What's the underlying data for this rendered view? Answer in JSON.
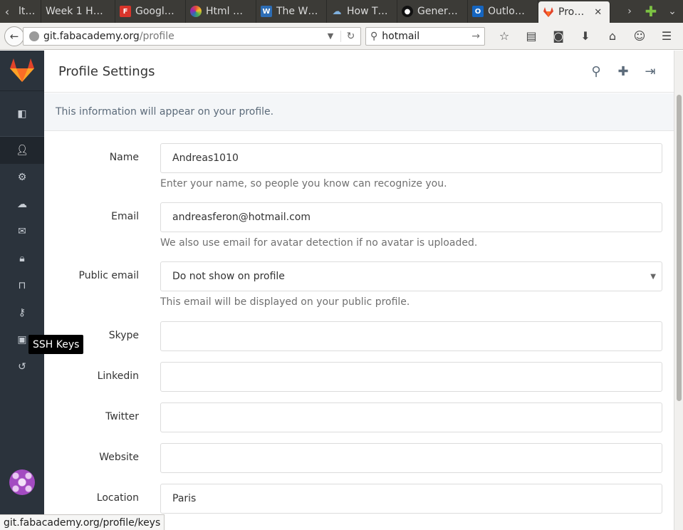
{
  "browser": {
    "tabs": [
      {
        "label": "lt…",
        "icon": "page-icon",
        "color": "#555555"
      },
      {
        "label": "Week 1 H…",
        "icon": "page-icon",
        "color": "#555555"
      },
      {
        "label": "Googl…",
        "icon": "fontawesome-icon",
        "color": "#d9352b"
      },
      {
        "label": "Html …",
        "icon": "color-wheel-icon",
        "color": "#e14a3c"
      },
      {
        "label": "The W…",
        "icon": "w3schools-icon",
        "color": "#2d6db5"
      },
      {
        "label": "How T…",
        "icon": "cloud-icon",
        "color": "#4a7fb0"
      },
      {
        "label": "Gener…",
        "icon": "github-icon",
        "color": "#222222"
      },
      {
        "label": "Outlo…",
        "icon": "outlook-icon",
        "color": "#1565c0"
      },
      {
        "label": "Pro…",
        "icon": "gitlab-icon",
        "color": "#e24329",
        "active": true
      }
    ],
    "url_host": "git.fabacademy.org",
    "url_path": "/profile",
    "search_text": "hotmail",
    "status_url": "git.fabacademy.org/profile/keys"
  },
  "sidebar": {
    "items": [
      {
        "name": "profile",
        "icon": "user-icon"
      },
      {
        "name": "account",
        "icon": "gear-icon"
      },
      {
        "name": "applications",
        "icon": "cloud-icon"
      },
      {
        "name": "emails",
        "icon": "envelope-icon"
      },
      {
        "name": "password",
        "icon": "lock-icon"
      },
      {
        "name": "notifications",
        "icon": "inbox-icon"
      },
      {
        "name": "ssh-keys",
        "icon": "key-icon"
      },
      {
        "name": "preferences",
        "icon": "image-icon"
      },
      {
        "name": "audit-log",
        "icon": "history-icon"
      }
    ],
    "tooltip": "SSH Keys"
  },
  "header": {
    "title": "Profile Settings"
  },
  "info": "This information will appear on your profile.",
  "form": {
    "name": {
      "label": "Name",
      "value": "Andreas1010",
      "help": "Enter your name, so people you know can recognize you."
    },
    "email": {
      "label": "Email",
      "value": "andreasferon@hotmail.com",
      "help": "We also use email for avatar detection if no avatar is uploaded."
    },
    "public_email": {
      "label": "Public email",
      "value": "Do not show on profile",
      "help": "This email will be displayed on your public profile."
    },
    "skype": {
      "label": "Skype",
      "value": ""
    },
    "linkedin": {
      "label": "Linkedin",
      "value": ""
    },
    "twitter": {
      "label": "Twitter",
      "value": ""
    },
    "website": {
      "label": "Website",
      "value": ""
    },
    "location": {
      "label": "Location",
      "value": "Paris"
    }
  },
  "colors": {
    "gitlab_orange": "#e24329",
    "sidebar_bg": "#2b333c"
  }
}
